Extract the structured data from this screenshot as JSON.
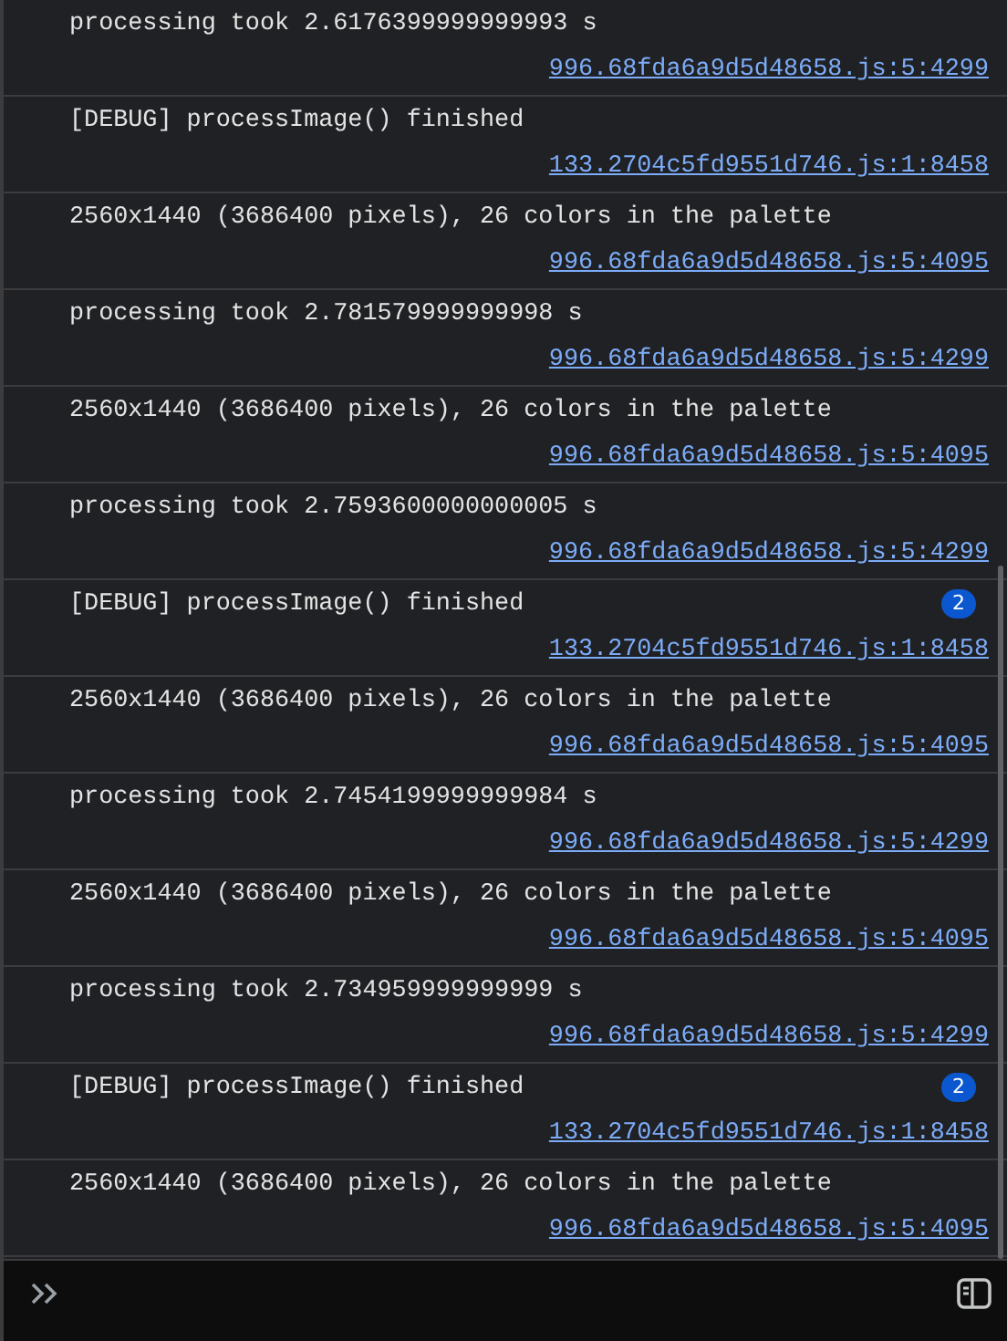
{
  "messages": [
    {
      "text": "processing took 2.6176399999999993 s",
      "source": "996.68fda6a9d5d48658.js:5:4299"
    },
    {
      "text": "[DEBUG] processImage() finished",
      "source": "133.2704c5fd9551d746.js:1:8458"
    },
    {
      "text": "2560x1440 (3686400 pixels), 26 colors in the palette",
      "source": "996.68fda6a9d5d48658.js:5:4095"
    },
    {
      "text": "processing took 2.781579999999998 s",
      "source": "996.68fda6a9d5d48658.js:5:4299"
    },
    {
      "text": "2560x1440 (3686400 pixels), 26 colors in the palette",
      "source": "996.68fda6a9d5d48658.js:5:4095"
    },
    {
      "text": "processing took 2.7593600000000005 s",
      "source": "996.68fda6a9d5d48658.js:5:4299"
    },
    {
      "text": "[DEBUG] processImage() finished",
      "count": "2",
      "source": "133.2704c5fd9551d746.js:1:8458"
    },
    {
      "text": "2560x1440 (3686400 pixels), 26 colors in the palette",
      "source": "996.68fda6a9d5d48658.js:5:4095"
    },
    {
      "text": "processing took 2.7454199999999984 s",
      "source": "996.68fda6a9d5d48658.js:5:4299"
    },
    {
      "text": "2560x1440 (3686400 pixels), 26 colors in the palette",
      "source": "996.68fda6a9d5d48658.js:5:4095"
    },
    {
      "text": "processing took 2.734959999999999 s",
      "source": "996.68fda6a9d5d48658.js:5:4299"
    },
    {
      "text": "[DEBUG] processImage() finished",
      "count": "2",
      "source": "133.2704c5fd9551d746.js:1:8458"
    },
    {
      "text": "2560x1440 (3686400 pixels), 26 colors in the palette",
      "source": "996.68fda6a9d5d48658.js:5:4095"
    }
  ]
}
